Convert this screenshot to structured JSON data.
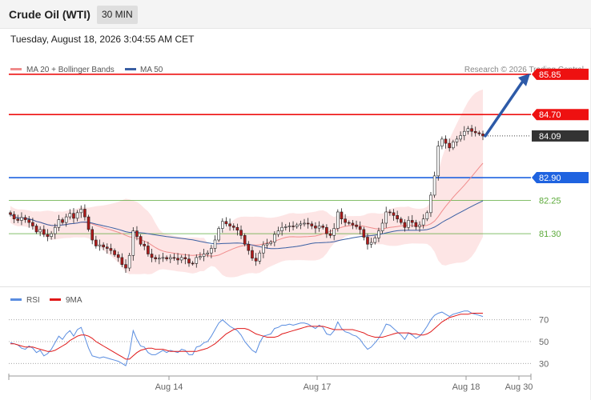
{
  "header": {
    "title": "Crude Oil (WTI)",
    "timeframe": "30 MIN",
    "datetime": "Tuesday, August 18, 2026 3:04:55 AM CET"
  },
  "colors": {
    "resistance": "#ee1111",
    "support": "#1f63e0",
    "support_weak": "#5caa3a",
    "bull_candle": "#ffffff",
    "bear_candle": "#b01a1a",
    "ma20": "#f08c8c",
    "ma50": "#3a5fa3",
    "bands_fill": "#fde0e0",
    "rsi": "#5a8de0",
    "rsi_ma": "#e01818",
    "arrow": "#2d5aa8",
    "last_price_bg": "#333333"
  },
  "chart_data": [
    {
      "type": "candlestick",
      "title": "",
      "legend_position": "top-left",
      "legend": [
        "MA 20 + Bollinger Bands",
        "MA 50"
      ],
      "credit": "Research © 2026 Trading Central",
      "y_range": [
        79.75,
        86.6
      ],
      "x_ticks": [
        "Aug 14",
        "Aug 17",
        "Aug 18",
        "Aug 30"
      ],
      "levels": [
        {
          "value": 85.85,
          "label": "85.85",
          "kind": "resistance"
        },
        {
          "value": 84.7,
          "label": "84.70",
          "kind": "resistance"
        },
        {
          "value": 84.09,
          "label": "84.09",
          "kind": "last_price"
        },
        {
          "value": 82.9,
          "label": "82.90",
          "kind": "support"
        },
        {
          "value": 82.25,
          "label": "82.25",
          "kind": "support_weak"
        },
        {
          "value": 81.3,
          "label": "81.30",
          "kind": "support_weak"
        }
      ],
      "projection": {
        "from": 84.09,
        "to": 85.85,
        "direction": "up"
      },
      "close": [
        81.85,
        81.72,
        81.68,
        81.76,
        81.7,
        81.62,
        81.52,
        81.35,
        81.42,
        81.28,
        81.22,
        81.3,
        81.48,
        81.7,
        81.62,
        81.78,
        81.88,
        81.74,
        81.9,
        82.0,
        81.78,
        81.42,
        81.12,
        80.95,
        80.98,
        80.92,
        80.88,
        80.82,
        80.7,
        80.62,
        80.42,
        80.32,
        80.68,
        81.38,
        81.22,
        81.0,
        80.95,
        80.72,
        80.62,
        80.58,
        80.6,
        80.62,
        80.58,
        80.62,
        80.6,
        80.55,
        80.62,
        80.58,
        80.46,
        80.45,
        80.62,
        80.65,
        80.72,
        80.75,
        80.88,
        81.12,
        81.45,
        81.65,
        81.58,
        81.52,
        81.48,
        81.4,
        81.25,
        81.0,
        80.82,
        80.6,
        80.52,
        80.75,
        80.98,
        81.02,
        81.06,
        81.28,
        81.38,
        81.48,
        81.5,
        81.52,
        81.5,
        81.55,
        81.58,
        81.6,
        81.58,
        81.52,
        81.46,
        81.52,
        81.48,
        81.3,
        81.25,
        81.45,
        81.92,
        81.72,
        81.62,
        81.6,
        81.55,
        81.5,
        81.42,
        81.2,
        81.0,
        81.05,
        81.18,
        81.38,
        81.6,
        81.92,
        81.9,
        81.82,
        81.72,
        81.62,
        81.48,
        81.68,
        81.62,
        81.5,
        81.55,
        81.72,
        81.9,
        82.4,
        82.95,
        83.8,
        84.0,
        83.88,
        83.75,
        83.92,
        84.0,
        84.1,
        84.22,
        84.3,
        84.22,
        84.18,
        84.15,
        84.09
      ]
    },
    {
      "type": "line",
      "title": "",
      "legend_position": "top-left",
      "legend": [
        "RSI",
        "9MA"
      ],
      "y_ticks": [
        30,
        50,
        70
      ],
      "y_range": [
        20,
        80
      ],
      "rsi": [
        49,
        48,
        47,
        44,
        43,
        46,
        44,
        40,
        42,
        37,
        39,
        43,
        49,
        55,
        52,
        57,
        60,
        55,
        61,
        63,
        54,
        44,
        37,
        36,
        35,
        36,
        35,
        34,
        33,
        32,
        30,
        28,
        40,
        60,
        52,
        46,
        45,
        40,
        38,
        38,
        40,
        42,
        40,
        42,
        41,
        40,
        43,
        42,
        38,
        38,
        45,
        46,
        49,
        50,
        55,
        61,
        67,
        70,
        67,
        64,
        62,
        60,
        56,
        50,
        46,
        42,
        40,
        49,
        55,
        56,
        57,
        62,
        63,
        65,
        65,
        66,
        65,
        66,
        67,
        67,
        66,
        64,
        62,
        65,
        63,
        57,
        56,
        60,
        68,
        62,
        59,
        58,
        56,
        55,
        52,
        47,
        43,
        45,
        49,
        53,
        59,
        66,
        65,
        62,
        59,
        56,
        52,
        58,
        56,
        53,
        55,
        59,
        64,
        70,
        74,
        76,
        77,
        75,
        73,
        75,
        76,
        77,
        78,
        78,
        76,
        75,
        74,
        73
      ],
      "rsi_ma": [
        48,
        48,
        47,
        46,
        45,
        45,
        45,
        44,
        43,
        42,
        41,
        41,
        42,
        44,
        46,
        48,
        51,
        53,
        55,
        56,
        56,
        55,
        53,
        50,
        48,
        46,
        44,
        42,
        40,
        38,
        36,
        34,
        34,
        37,
        40,
        42,
        43,
        44,
        44,
        43,
        43,
        43,
        42,
        41,
        41,
        41,
        41,
        41,
        41,
        41,
        41,
        42,
        43,
        44,
        46,
        48,
        51,
        54,
        57,
        59,
        61,
        62,
        62,
        62,
        61,
        59,
        57,
        56,
        55,
        54,
        54,
        54,
        55,
        57,
        58,
        59,
        60,
        61,
        62,
        63,
        64,
        64,
        64,
        64,
        64,
        63,
        62,
        61,
        61,
        61,
        61,
        61,
        61,
        60,
        59,
        58,
        56,
        55,
        54,
        54,
        54,
        55,
        56,
        57,
        58,
        58,
        58,
        58,
        57,
        57,
        56,
        56,
        57,
        59,
        62,
        65,
        68,
        70,
        72,
        73,
        74,
        75,
        75,
        75,
        76,
        76,
        76,
        76
      ]
    }
  ]
}
